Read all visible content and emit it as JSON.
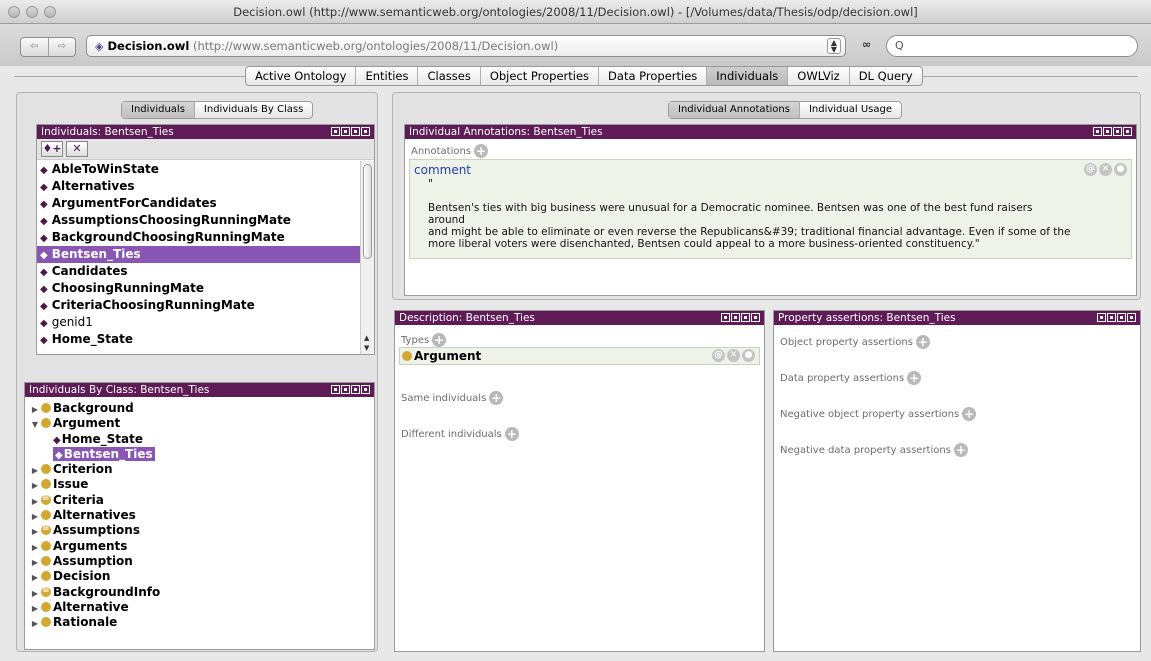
{
  "window": {
    "title": "Decision.owl (http://www.semanticweb.org/ontologies/2008/11/Decision.owl) - [/Volumes/data/Thesis/odp/decision.owl]"
  },
  "toolbar": {
    "back_label": "⇦",
    "forward_label": "⇨",
    "ontology_name": "Decision.owl",
    "ontology_iri": "(http://www.semanticweb.org/ontologies/2008/11/Decision.owl)",
    "search_placeholder": "Q"
  },
  "tabs": [
    "Active Ontology",
    "Entities",
    "Classes",
    "Object Properties",
    "Data Properties",
    "Individuals",
    "OWLViz",
    "DL Query"
  ],
  "active_tab": "Individuals",
  "left_group": {
    "subtabs": [
      "Individuals",
      "Individuals By Class"
    ],
    "individuals_view": {
      "title": "Individuals: Bentsen_Ties",
      "items": [
        {
          "label": "AbleToWinState",
          "bold": true
        },
        {
          "label": "Alternatives",
          "bold": true
        },
        {
          "label": "ArgumentForCandidates",
          "bold": true
        },
        {
          "label": "AssumptionsChoosingRunningMate",
          "bold": true
        },
        {
          "label": "BackgroundChoosingRunningMate",
          "bold": true
        },
        {
          "label": "Bentsen_Ties",
          "bold": true,
          "selected": true
        },
        {
          "label": "Candidates",
          "bold": true
        },
        {
          "label": "ChoosingRunningMate",
          "bold": true
        },
        {
          "label": "CriteriaChoosingRunningMate",
          "bold": true
        },
        {
          "label": "genid1",
          "bold": false
        },
        {
          "label": "Home_State",
          "bold": true
        }
      ]
    },
    "by_class_view": {
      "title": "Individuals By Class: Bentsen_Ties",
      "tree": [
        {
          "label": "Background",
          "level": 0,
          "toggle": "▶",
          "kind": "class"
        },
        {
          "label": "Argument",
          "level": 0,
          "toggle": "▼",
          "kind": "class"
        },
        {
          "label": "Home_State",
          "level": 1,
          "toggle": "",
          "kind": "individual"
        },
        {
          "label": "Bentsen_Ties",
          "level": 1,
          "toggle": "",
          "kind": "individual",
          "selected": true
        },
        {
          "label": "Criterion",
          "level": 0,
          "toggle": "▶",
          "kind": "class"
        },
        {
          "label": "Issue",
          "level": 0,
          "toggle": "▶",
          "kind": "class"
        },
        {
          "label": "Criteria",
          "level": 0,
          "toggle": "▶",
          "kind": "defined"
        },
        {
          "label": "Alternatives",
          "level": 0,
          "toggle": "▶",
          "kind": "class"
        },
        {
          "label": "Assumptions",
          "level": 0,
          "toggle": "▶",
          "kind": "defined"
        },
        {
          "label": "Arguments",
          "level": 0,
          "toggle": "▶",
          "kind": "class"
        },
        {
          "label": "Assumption",
          "level": 0,
          "toggle": "▶",
          "kind": "class"
        },
        {
          "label": "Decision",
          "level": 0,
          "toggle": "▶",
          "kind": "class"
        },
        {
          "label": "BackgroundInfo",
          "level": 0,
          "toggle": "▶",
          "kind": "defined"
        },
        {
          "label": "Alternative",
          "level": 0,
          "toggle": "▶",
          "kind": "class"
        },
        {
          "label": "Rationale",
          "level": 0,
          "toggle": "▶",
          "kind": "class"
        }
      ]
    }
  },
  "right_group": {
    "subtabs": [
      "Individual Annotations",
      "Individual Usage"
    ],
    "annotations_view": {
      "title": "Individual Annotations: Bentsen_Ties",
      "section_label": "Annotations",
      "property": "comment",
      "text": "\"\n\nBentsen's ties with big business were unusual for a Democratic nominee. Bentsen was one of the best fund raisers around\nand might be able to eliminate or even reverse the Republicans&#39; traditional financial advantage. Even if some of the\nmore liberal voters were disenchanted, Bentsen could appeal to a more business-oriented constituency.\""
    }
  },
  "description_view": {
    "title": "Description: Bentsen_Ties",
    "types_label": "Types",
    "type_value": "Argument",
    "same_label": "Same individuals",
    "different_label": "Different individuals"
  },
  "property_view": {
    "title": "Property assertions: Bentsen_Ties",
    "object_label": "Object property assertions",
    "data_label": "Data property assertions",
    "neg_object_label": "Negative object property assertions",
    "neg_data_label": "Negative data property assertions"
  },
  "colors": {
    "view_header": "#5e1b56",
    "selection": "#8a56b5",
    "class_circle": "#d4a732",
    "annotation_bg": "#eef3ea"
  }
}
